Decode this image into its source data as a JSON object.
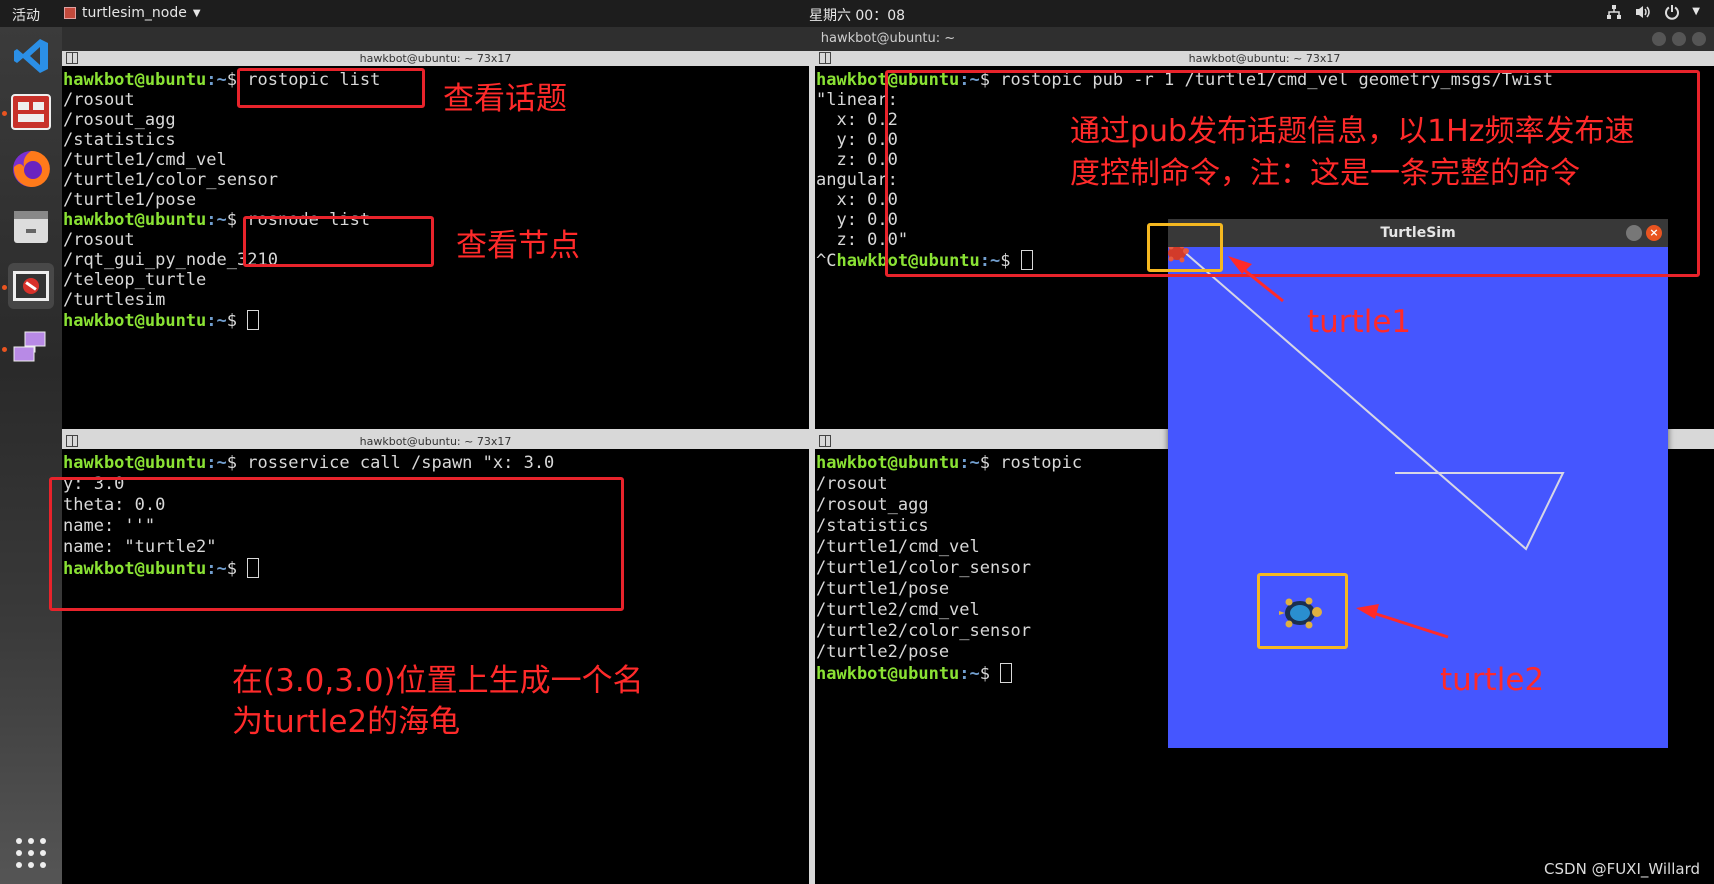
{
  "topbar": {
    "activities": "活动",
    "app_name": "turtlesim_node",
    "clock": "星期六 00：08"
  },
  "terminal": {
    "title": "hawkbot@ubuntu: ~",
    "panes": {
      "top_left": {
        "header": "hawkbot@ubuntu: ~ 73x17",
        "lines": [
          {
            "prompt": "hawkbot@ubuntu",
            "path": ":~",
            "cmd": "$ rostopic list"
          },
          {
            "text": "/rosout"
          },
          {
            "text": "/rosout_agg"
          },
          {
            "text": "/statistics"
          },
          {
            "text": "/turtle1/cmd_vel"
          },
          {
            "text": "/turtle1/color_sensor"
          },
          {
            "text": "/turtle1/pose"
          },
          {
            "prompt": "hawkbot@ubuntu",
            "path": ":~",
            "cmd": "$ rosnode list"
          },
          {
            "text": "/rosout"
          },
          {
            "text": "/rqt_gui_py_node_3210"
          },
          {
            "text": "/teleop_turtle"
          },
          {
            "text": "/turtlesim"
          },
          {
            "prompt": "hawkbot@ubuntu",
            "path": ":~",
            "cmd": "$ ",
            "cursor": true
          }
        ]
      },
      "top_right": {
        "header": "hawkbot@ubuntu: ~ 73x17",
        "lines": [
          {
            "prompt": "hawkbot@ubuntu",
            "path": ":~",
            "cmd": "$ rostopic pub -r 1 /turtle1/cmd_vel geometry_msgs/Twist"
          },
          {
            "text": "\"linear:"
          },
          {
            "text": "  x: 0.2"
          },
          {
            "text": "  y: 0.0"
          },
          {
            "text": "  z: 0.0"
          },
          {
            "text": "angular:"
          },
          {
            "text": "  x: 0.0"
          },
          {
            "text": "  y: 0.0"
          },
          {
            "text": "  z: 0.0\""
          },
          {
            "pre": "^C",
            "prompt": "hawkbot@ubuntu",
            "path": ":~",
            "cmd": "$ ",
            "cursor": true
          }
        ]
      },
      "bottom_left": {
        "header": "hawkbot@ubuntu: ~ 73x17",
        "lines": [
          {
            "prompt": "hawkbot@ubuntu",
            "path": ":~",
            "cmd": "$ rosservice call /spawn \"x: 3.0"
          },
          {
            "text": "y: 3.0"
          },
          {
            "text": "theta: 0.0"
          },
          {
            "text": "name: ''\""
          },
          {
            "text": "name: \"turtle2\""
          },
          {
            "prompt": "hawkbot@ubuntu",
            "path": ":~",
            "cmd": "$ ",
            "cursor": true
          }
        ]
      },
      "bottom_right": {
        "lines": [
          {
            "prompt": "hawkbot@ubuntu",
            "path": ":~",
            "cmd": "$ rostopic"
          },
          {
            "text": "/rosout"
          },
          {
            "text": "/rosout_agg"
          },
          {
            "text": "/statistics"
          },
          {
            "text": "/turtle1/cmd_vel"
          },
          {
            "text": "/turtle1/color_sensor"
          },
          {
            "text": "/turtle1/pose"
          },
          {
            "text": "/turtle2/cmd_vel"
          },
          {
            "text": "/turtle2/color_sensor"
          },
          {
            "text": "/turtle2/pose"
          },
          {
            "prompt": "hawkbot@ubuntu",
            "path": ":~",
            "cmd": "$ ",
            "cursor": true
          }
        ]
      }
    }
  },
  "annotations": {
    "topic_note": "查看话题",
    "node_note": "查看节点",
    "pub_note": "通过pub发布话题信息，以1Hz频率发布速\n度控制命令，注：这是一条完整的命令",
    "spawn_note": "在(3.0,3.0)位置上生成一个名\n为turtle2的海龟",
    "turtle1_label": "turtle1",
    "turtle2_label": "turtle2"
  },
  "turtlesim": {
    "title": "TurtleSim",
    "background_color": "#4556ff",
    "turtle1_pose": {
      "x": 0.2,
      "y": 10.6
    },
    "turtle2_pose": {
      "x": 3.0,
      "y": 3.0
    }
  },
  "colors": {
    "prompt": "#8ae234",
    "path": "#729fcf",
    "annotation": "#e8232b",
    "highlight": "#f5b820"
  },
  "watermark": "CSDN @FUXI_Willard"
}
